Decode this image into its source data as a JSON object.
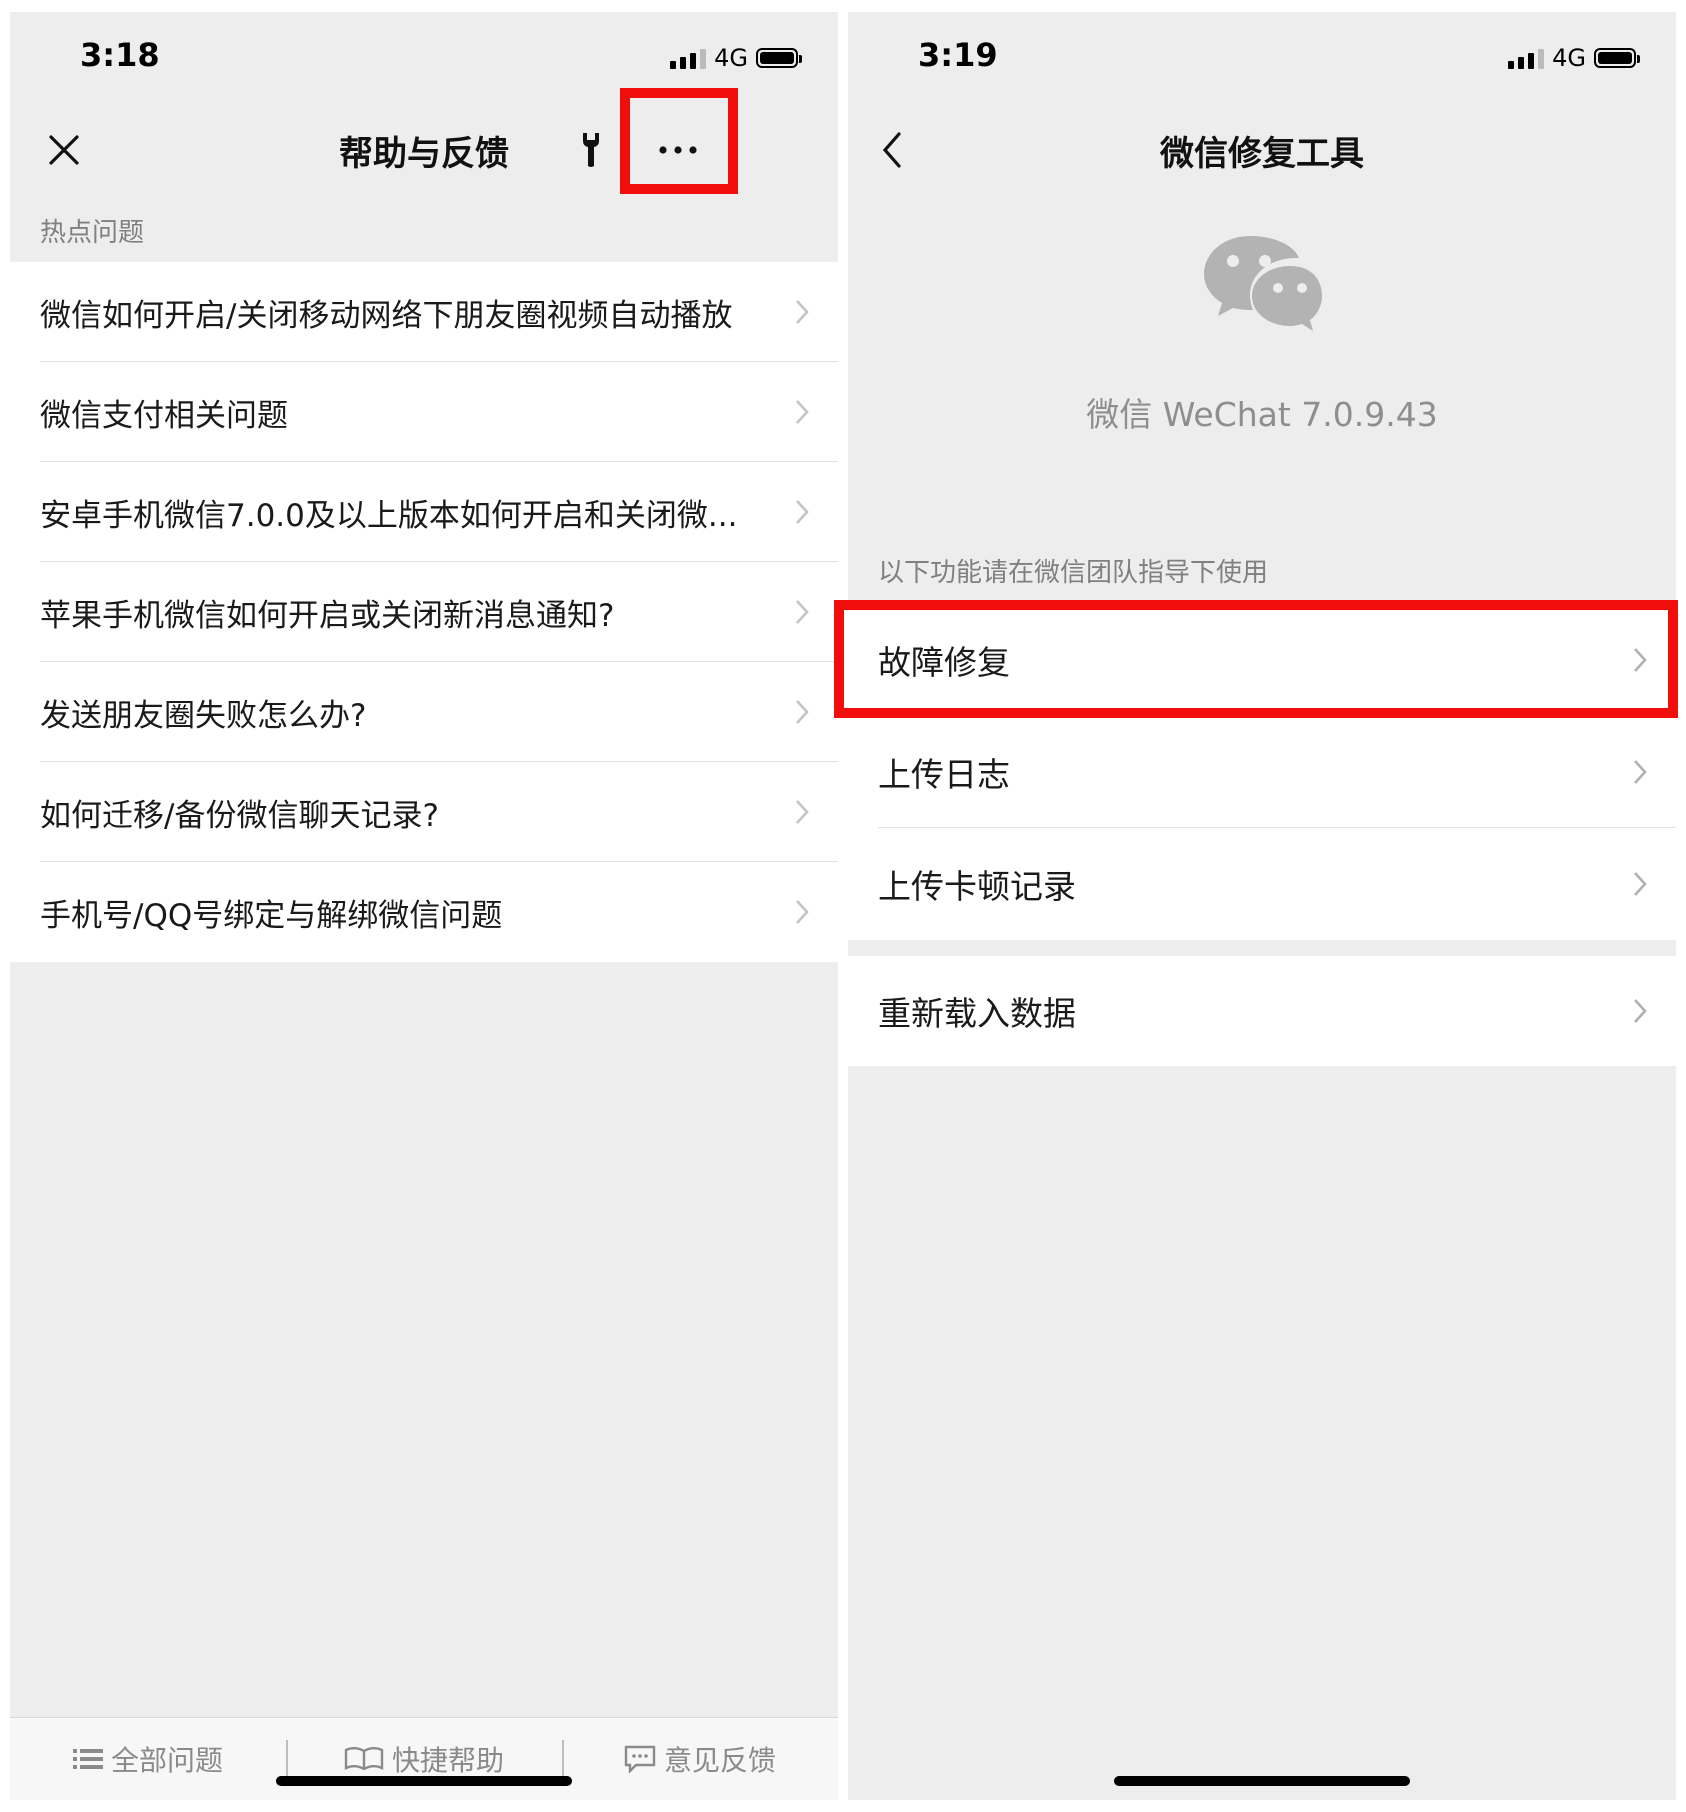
{
  "left_screen": {
    "status": {
      "time": "3:18",
      "network": "4G"
    },
    "nav": {
      "title": "帮助与反馈"
    },
    "section": {
      "label": "热点问题"
    },
    "faq_items": [
      "微信如何开启/关闭移动网络下朋友圈视频自动播放",
      "微信支付相关问题",
      "安卓手机微信7.0.0及以上版本如何开启和关闭微...",
      "苹果手机微信如何开启或关闭新消息通知?",
      "发送朋友圈失败怎么办?",
      "如何迁移/备份微信聊天记录?",
      "手机号/QQ号绑定与解绑微信问题"
    ],
    "tabs": [
      "全部问题",
      "快捷帮助",
      "意见反馈"
    ]
  },
  "right_screen": {
    "status": {
      "time": "3:19",
      "network": "4G"
    },
    "nav": {
      "title": "微信修复工具"
    },
    "app": {
      "version_text": "微信 WeChat 7.0.9.43"
    },
    "section": {
      "label": "以下功能请在微信团队指导下使用"
    },
    "tools_group1": [
      "故障修复",
      "上传日志",
      "上传卡顿记录"
    ],
    "tools_group2": [
      "重新载入数据"
    ]
  },
  "colors": {
    "highlight": "#f20d0d",
    "background": "#ededed",
    "logo": "#b3b3b3"
  },
  "icons": [
    "close-icon",
    "wrench-icon",
    "more-icon",
    "back-icon",
    "wechat-logo-icon",
    "chevron-right-icon",
    "list-icon",
    "book-icon",
    "feedback-icon"
  ]
}
